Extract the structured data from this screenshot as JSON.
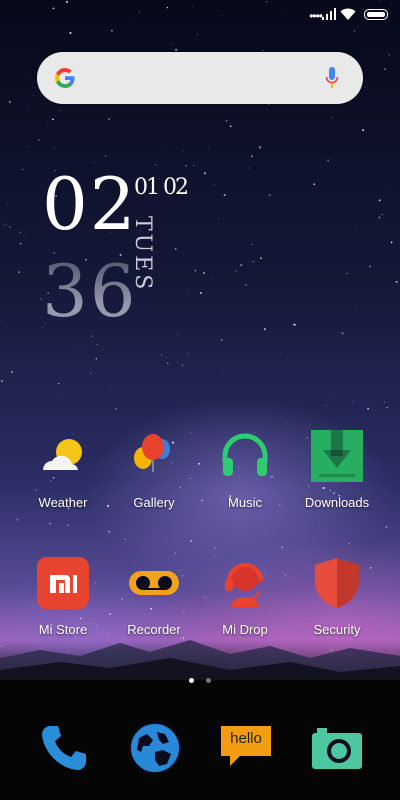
{
  "status_bar": {
    "icons": [
      "signal-dots-icon",
      "signal-bars-icon",
      "wifi-icon",
      "battery-icon"
    ]
  },
  "search": {
    "icons": [
      "google-g-icon",
      "microphone-icon"
    ]
  },
  "clock": {
    "hour": "02",
    "minute": "36",
    "date": "01 02",
    "day": "TUES"
  },
  "apps": [
    {
      "label": "Weather",
      "icon": "weather-icon"
    },
    {
      "label": "Gallery",
      "icon": "gallery-balloons-icon"
    },
    {
      "label": "Music",
      "icon": "headphones-icon"
    },
    {
      "label": "Downloads",
      "icon": "download-icon"
    },
    {
      "label": "Mi Store",
      "icon": "mi-store-icon"
    },
    {
      "label": "Recorder",
      "icon": "recorder-icon"
    },
    {
      "label": "Mi Drop",
      "icon": "mi-drop-icon"
    },
    {
      "label": "Security",
      "icon": "security-shield-icon"
    }
  ],
  "page_indicator": {
    "pages": 2,
    "current": 1
  },
  "dock": [
    {
      "icon": "phone-icon"
    },
    {
      "icon": "browser-globe-icon"
    },
    {
      "icon": "messaging-icon",
      "text": "hello"
    },
    {
      "icon": "camera-icon"
    }
  ],
  "colors": {
    "accent_orange": "#f39c12",
    "downloads_green": "#27ae60",
    "mi_red": "#e74c3c",
    "recorder_orange": "#f1a21c",
    "phone_blue": "#2a8ed8"
  }
}
